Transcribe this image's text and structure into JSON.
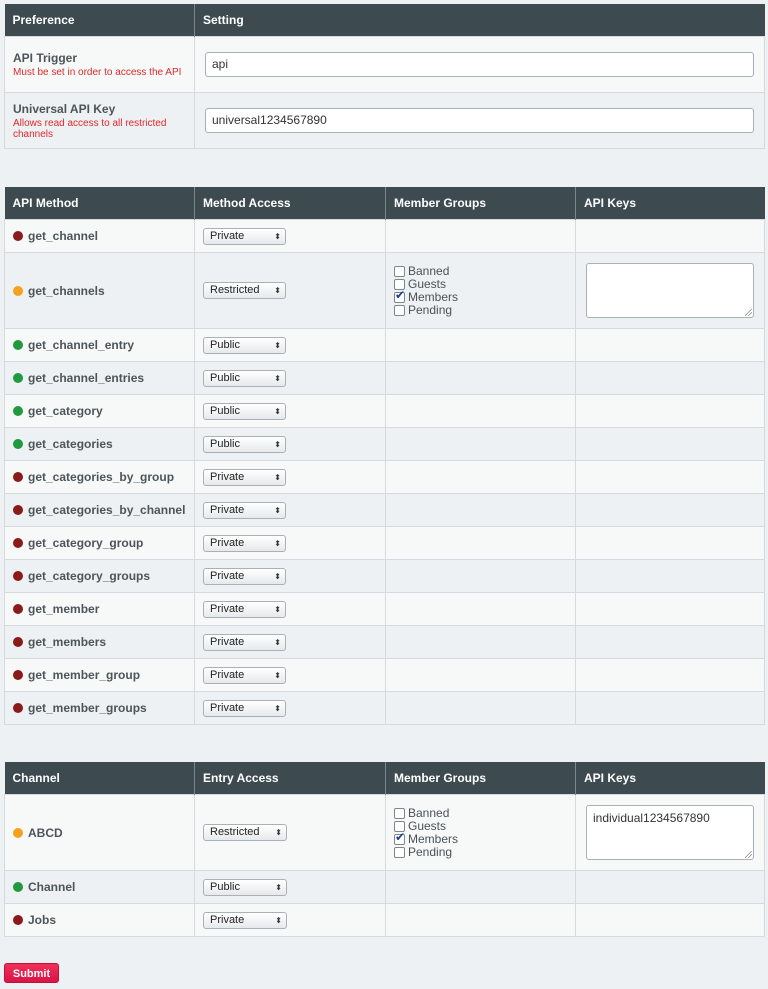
{
  "preferences": {
    "headers": [
      "Preference",
      "Setting"
    ],
    "rows": [
      {
        "name": "API Trigger",
        "hint": "Must be set in order to access the API",
        "value": "api"
      },
      {
        "name": "Universal API Key",
        "hint": "Allows read access to all restricted channels",
        "value": "universal1234567890"
      }
    ]
  },
  "methods": {
    "headers": [
      "API Method",
      "Method Access",
      "Member Groups",
      "API Keys"
    ],
    "rows": [
      {
        "name": "get_channel",
        "access": "Private"
      },
      {
        "name": "get_channels",
        "access": "Restricted",
        "groups": [
          {
            "label": "Banned",
            "checked": false
          },
          {
            "label": "Guests",
            "checked": false
          },
          {
            "label": "Members",
            "checked": true
          },
          {
            "label": "Pending",
            "checked": false
          }
        ],
        "api_keys": ""
      },
      {
        "name": "get_channel_entry",
        "access": "Public"
      },
      {
        "name": "get_channel_entries",
        "access": "Public"
      },
      {
        "name": "get_category",
        "access": "Public"
      },
      {
        "name": "get_categories",
        "access": "Public"
      },
      {
        "name": "get_categories_by_group",
        "access": "Private"
      },
      {
        "name": "get_categories_by_channel",
        "access": "Private"
      },
      {
        "name": "get_category_group",
        "access": "Private"
      },
      {
        "name": "get_category_groups",
        "access": "Private"
      },
      {
        "name": "get_member",
        "access": "Private"
      },
      {
        "name": "get_members",
        "access": "Private"
      },
      {
        "name": "get_member_group",
        "access": "Private"
      },
      {
        "name": "get_member_groups",
        "access": "Private"
      }
    ]
  },
  "channels": {
    "headers": [
      "Channel",
      "Entry Access",
      "Member Groups",
      "API Keys"
    ],
    "rows": [
      {
        "name": "ABCD",
        "access": "Restricted",
        "groups": [
          {
            "label": "Banned",
            "checked": false
          },
          {
            "label": "Guests",
            "checked": false
          },
          {
            "label": "Members",
            "checked": true
          },
          {
            "label": "Pending",
            "checked": false
          }
        ],
        "api_keys": "individual1234567890"
      },
      {
        "name": "Channel",
        "access": "Public"
      },
      {
        "name": "Jobs",
        "access": "Private"
      }
    ]
  },
  "access_colors": {
    "Private": "#8b1a1a",
    "Restricted": "#f4a21e",
    "Public": "#1f9a3e"
  },
  "icons": {
    "select_arrow": "updown-arrows-icon",
    "status": "status-dot-icon"
  },
  "submit_label": "Submit"
}
